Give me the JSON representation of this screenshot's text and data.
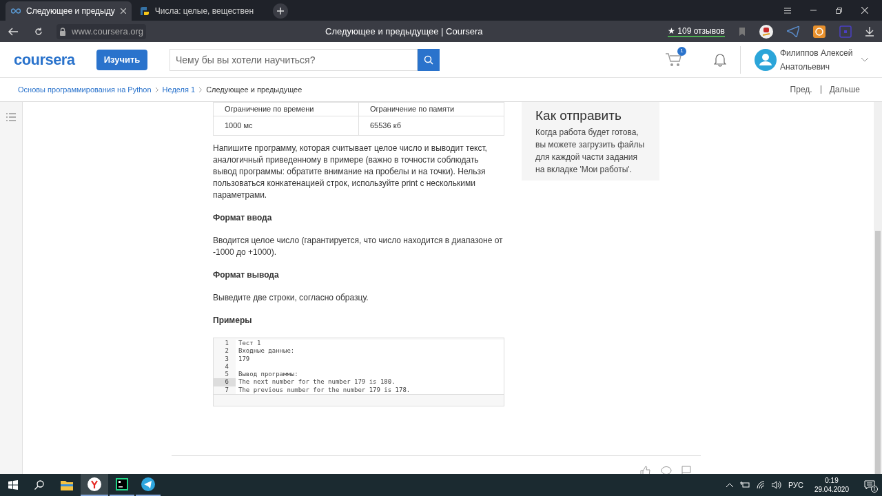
{
  "browser": {
    "tabs": [
      {
        "title": "Следующее и предыду",
        "selected": true
      },
      {
        "title": "Числа: целые, веществен",
        "selected": false
      }
    ],
    "address": "www.coursera.org",
    "page_title": "Следующее и предыдущее | Coursera",
    "reviews": "★ 109 отзывов"
  },
  "header": {
    "logo": "coursera",
    "explore_button": "Изучить",
    "search": {
      "placeholder": "Чему бы вы хотели научиться?"
    },
    "cart_count": "1",
    "user_name": "Филиппов Алексей Анатольевич"
  },
  "breadcrumb": {
    "items": [
      {
        "label": "Основы программирования на Python",
        "kind": "link"
      },
      {
        "label": "Неделя 1",
        "kind": "link"
      },
      {
        "label": "Следующее и предыдущее",
        "kind": "current"
      }
    ],
    "prev": "Пред.",
    "next": "Дальше"
  },
  "limits_table": {
    "columns": [
      "Ограничение по времени",
      "Ограничение по памяти"
    ],
    "rows": [
      [
        "1000 мс",
        "65536 кб"
      ]
    ]
  },
  "content": [
    {
      "kind": "paragraph",
      "text": "Напишите программу, которая считывает целое число и выводит текст, аналогичный приведенному в примере (важно в точности соблюдать вывод программы: обратите внимание на пробелы и на точки). Нельзя пользоваться конкатенацией строк, используйте print с несколькими параметрами."
    },
    {
      "kind": "heading",
      "text": "Формат ввода"
    },
    {
      "kind": "paragraph",
      "text": "Вводится целое число (гарантируется, что число находится в диапазоне от -1000 до +1000)."
    },
    {
      "kind": "heading",
      "text": "Формат вывода"
    },
    {
      "kind": "paragraph",
      "text": "Выведите две строки, согласно образцу."
    },
    {
      "kind": "heading",
      "text": "Примеры"
    }
  ],
  "code": {
    "lines": [
      {
        "number": "1",
        "text": "Тест 1",
        "selected": false
      },
      {
        "number": "2",
        "text": "Входные данные:",
        "selected": false
      },
      {
        "number": "3",
        "text": "179",
        "selected": false
      },
      {
        "number": "4",
        "selected": false
      },
      {
        "number": "5",
        "text": "Вывод программы:",
        "selected": false
      },
      {
        "number": "6",
        "text": "The next number for the number 179 is 180.",
        "selected": true
      },
      {
        "number": "7",
        "text": "The previous number for the number 179 is 178.",
        "selected": false
      }
    ]
  },
  "aside": {
    "title": "Как отправить",
    "text": "Когда работа будет готова, вы можете загрузить файлы для каждой части задания на вкладке 'Мои работы'."
  },
  "taskbar": {
    "language": "РУС",
    "time": "0:19",
    "date": "29.04.2020",
    "notifications": "1"
  }
}
